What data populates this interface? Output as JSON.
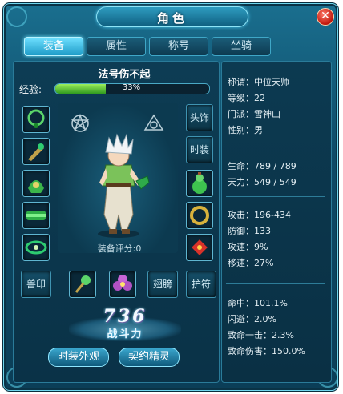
{
  "window": {
    "title": "角色",
    "close_label": "✕"
  },
  "tabs": [
    {
      "label": "装备",
      "active": true
    },
    {
      "label": "属性",
      "active": false
    },
    {
      "label": "称号",
      "active": false
    },
    {
      "label": "坐骑",
      "active": false
    }
  ],
  "character": {
    "name": "法号伤不起",
    "exp_label": "经验:",
    "exp_text": "33%",
    "exp_fraction": 0.33,
    "score_label": "装备评分:0",
    "combat_power": "736",
    "combat_power_label": "战斗力"
  },
  "slots": {
    "headwear": "头饰",
    "fashion": "时装",
    "beast_seal": "兽印",
    "wings": "翅膀",
    "amulet": "护符"
  },
  "buttons": {
    "fashion_view": "时装外观",
    "contract_spirit": "契约精灵"
  },
  "stats": {
    "group1": [
      "称谓：中位天师",
      "等级：22",
      "门派：雪神山",
      "性别：男"
    ],
    "group2": [
      "生命：789 / 789",
      "天力：549 / 549"
    ],
    "group3": [
      "攻击：196-434",
      "防御：133",
      "攻速：9%",
      "移速：27%"
    ],
    "group4": [
      "命中：101.1%",
      "闪避：2.0%",
      "致命一击：2.3%",
      "致命伤害：150.0%"
    ]
  },
  "colors": {
    "accent": "#6fe0ff",
    "frame": "#0e4a66",
    "exp_fill": "#2f9a1f",
    "close": "#c0180c"
  }
}
